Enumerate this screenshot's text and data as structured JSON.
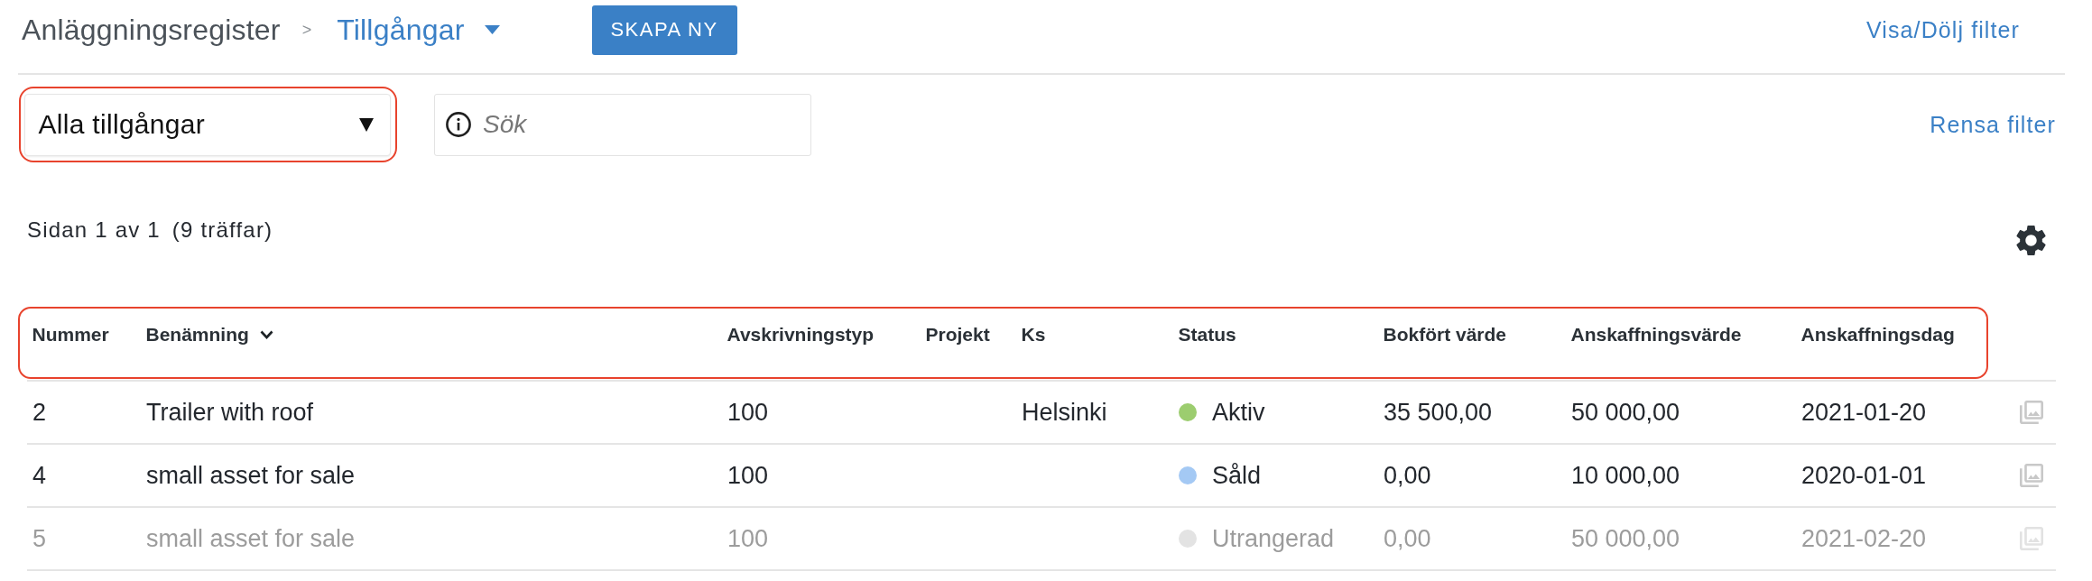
{
  "breadcrumb": {
    "parent": "Anläggningsregister",
    "separator": ">",
    "current": "Tillgångar"
  },
  "create_button": {
    "label": "SKAPA NY"
  },
  "filter_toggle": {
    "label": "Visa/Dölj filter"
  },
  "filters": {
    "asset_select": {
      "value": "Alla tillgångar",
      "highlighted": true
    },
    "search": {
      "placeholder": "Sök"
    },
    "clear_link": {
      "label": "Rensa filter"
    }
  },
  "pagination": {
    "page_info": "Sidan 1 av 1",
    "hit_count": "(9 träffar)"
  },
  "table": {
    "header_highlighted": true,
    "columns": [
      {
        "label": "Nummer",
        "sorted": false
      },
      {
        "label": "Benämning",
        "sorted": true
      },
      {
        "label": "Avskrivningstyp",
        "sorted": false
      },
      {
        "label": "Projekt",
        "sorted": false
      },
      {
        "label": "Ks",
        "sorted": false
      },
      {
        "label": "Status",
        "sorted": false
      },
      {
        "label": "Bokfört värde",
        "sorted": false
      },
      {
        "label": "Anskaffningsvärde",
        "sorted": false
      },
      {
        "label": "Anskaffningsdag",
        "sorted": false
      }
    ],
    "rows": [
      {
        "number": "2",
        "name": "Trailer with roof",
        "depreciation_type": "100",
        "cost_center": "Helsinki",
        "status": {
          "label": "Aktiv",
          "color": "#9ccd6f"
        },
        "book_value": "35 500,00",
        "acquisition_value": "50 000,00",
        "acquisition_date": "2021-01-20",
        "inactive": false
      },
      {
        "number": "4",
        "name": "small asset for sale",
        "depreciation_type": "100",
        "status": {
          "label": "Såld",
          "color": "#a4c9f4"
        },
        "book_value": "0,00",
        "acquisition_value": "10 000,00",
        "acquisition_date": "2020-01-01",
        "inactive": false
      },
      {
        "number": "5",
        "name": "small asset for sale",
        "depreciation_type": "100",
        "status": {
          "label": "Utrangerad",
          "color": "#e3e3e3"
        },
        "book_value": "0,00",
        "acquisition_value": "50 000,00",
        "acquisition_date": "2021-02-20",
        "inactive": true
      }
    ]
  }
}
